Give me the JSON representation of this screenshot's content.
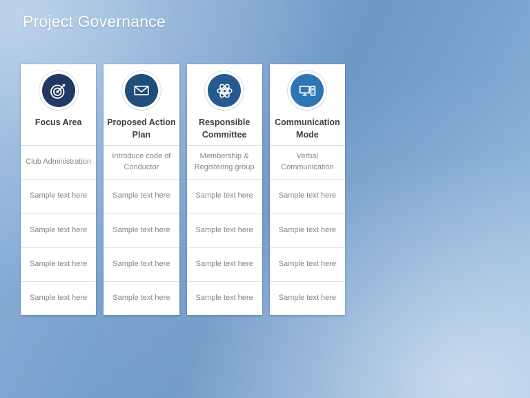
{
  "slide": {
    "title": "Project Governance",
    "title_color": "#ffffff",
    "background_colors": [
      "#8db4dc",
      "#6e98c6",
      "#95bce2"
    ]
  },
  "theme": {
    "card_background": "#ffffff",
    "header_text_color": "#3f3f3f",
    "cell_text_color": "#848484",
    "divider_color": "#e2e2e2"
  },
  "columns": [
    {
      "icon": "target-bullseye-icon",
      "icon_color": "#1f3864",
      "title": "Focus Area",
      "cells": [
        "Club Administration",
        "Sample text here",
        "Sample text here",
        "Sample text here",
        "Sample text here"
      ]
    },
    {
      "icon": "envelope-mail-icon",
      "icon_color": "#1f4e79",
      "title": "Proposed Action Plan",
      "cells": [
        "Introduce code of Conductor",
        "Sample text here",
        "Sample text here",
        "Sample text here",
        "Sample text here"
      ]
    },
    {
      "icon": "atom-icon",
      "icon_color": "#265a8f",
      "title": "Responsible Committee",
      "cells": [
        "Membership & Registering group",
        "Sample text here",
        "Sample text here",
        "Sample text here",
        "Sample text here"
      ]
    },
    {
      "icon": "desktop-computer-icon",
      "icon_color": "#2e75b6",
      "title": "Communication Mode",
      "cells": [
        "Verbal Communication",
        "Sample text here",
        "Sample text here",
        "Sample text here",
        "Sample text here"
      ]
    }
  ]
}
